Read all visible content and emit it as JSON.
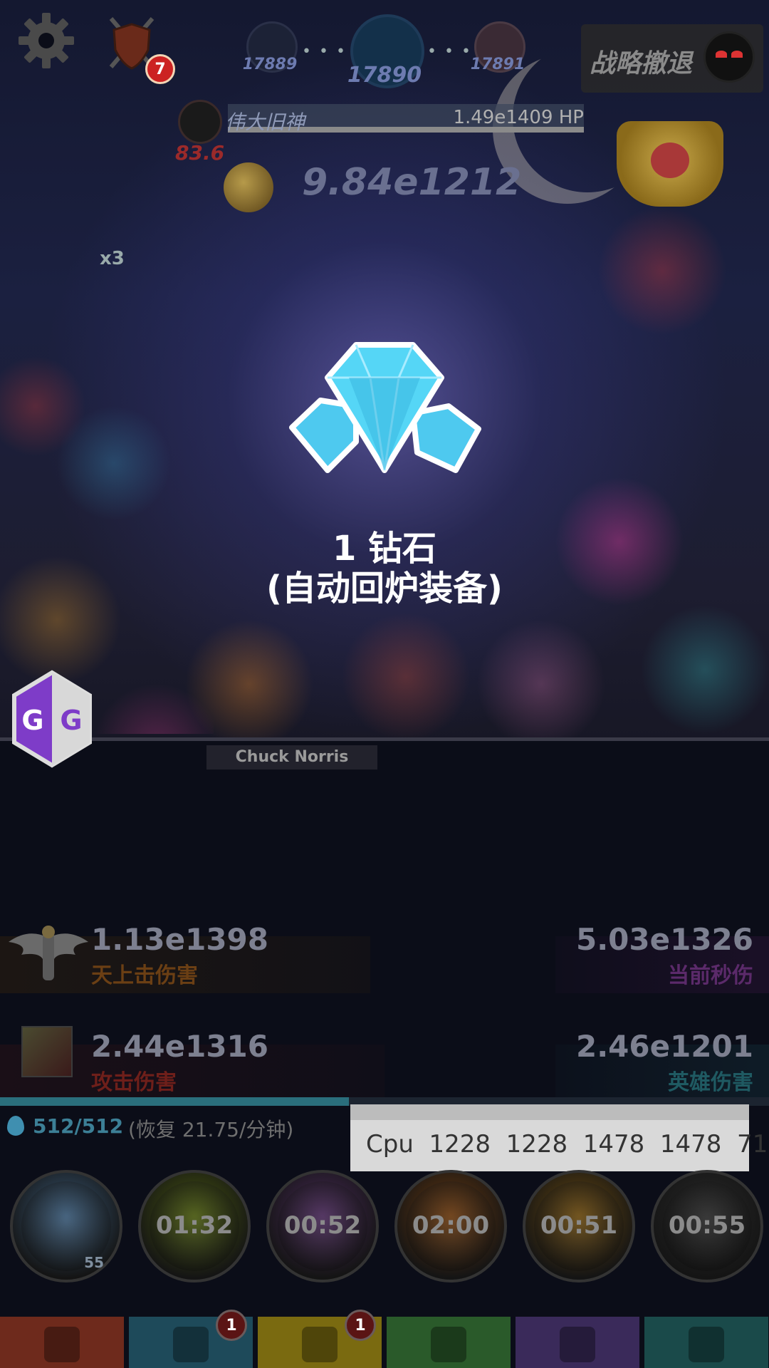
{
  "top_bar": {
    "shield_badge": "7",
    "stages": [
      {
        "label": "17889"
      },
      {
        "label": "17890"
      },
      {
        "label": "17891"
      }
    ],
    "retreat_label": "战略撤退"
  },
  "boss": {
    "name": "伟大旧神",
    "hp": "1.49e1409 HP",
    "timer": "83.6"
  },
  "gold": {
    "value": "9.84e1212",
    "multiplier": "x3"
  },
  "reward": {
    "line1": "1 钻石",
    "line2": "(自动回炉装备)"
  },
  "hero_name": "Chuck Norris",
  "stats": {
    "sky_strike": {
      "value": "1.13e1398",
      "label": "天上击伤害",
      "label_color": "#6b3f14"
    },
    "dps": {
      "value": "5.03e1326",
      "label": "当前秒伤",
      "label_color": "#5b2a6a"
    },
    "attack": {
      "value": "2.44e1316",
      "label": "攻击伤害",
      "label_color": "#6e1f1a"
    },
    "hero": {
      "value": "2.46e1201",
      "label": "英雄伤害",
      "label_color": "#1f5a62"
    }
  },
  "energy": {
    "count": "512/512",
    "recovery": "(恢复 21.75/分钟)",
    "fill": 0.45
  },
  "cpu_overlay": "Cpu  1228  1228  1478  1478  71",
  "skills": [
    {
      "time": "",
      "count": "55",
      "color": "#3a5a78"
    },
    {
      "time": "01:32",
      "count": "",
      "color": "#4a5a10"
    },
    {
      "time": "00:52",
      "count": "",
      "color": "#4a2a5a"
    },
    {
      "time": "02:00",
      "count": "",
      "color": "#6a3a10"
    },
    {
      "time": "00:51",
      "count": "",
      "color": "#6a4a10"
    },
    {
      "time": "00:55",
      "count": "",
      "color": "#2a2a2a"
    }
  ],
  "tabs": [
    {
      "name": "sword",
      "color": "#6e2a1c",
      "badge": ""
    },
    {
      "name": "heroes",
      "color": "#1e4a5a",
      "badge": "1"
    },
    {
      "name": "equipment",
      "color": "#7a6a10",
      "badge": "1"
    },
    {
      "name": "pets",
      "color": "#2a5a2a",
      "badge": ""
    },
    {
      "name": "relics",
      "color": "#3a2a5a",
      "badge": ""
    },
    {
      "name": "shop",
      "color": "#1a4a4a",
      "badge": ""
    }
  ]
}
